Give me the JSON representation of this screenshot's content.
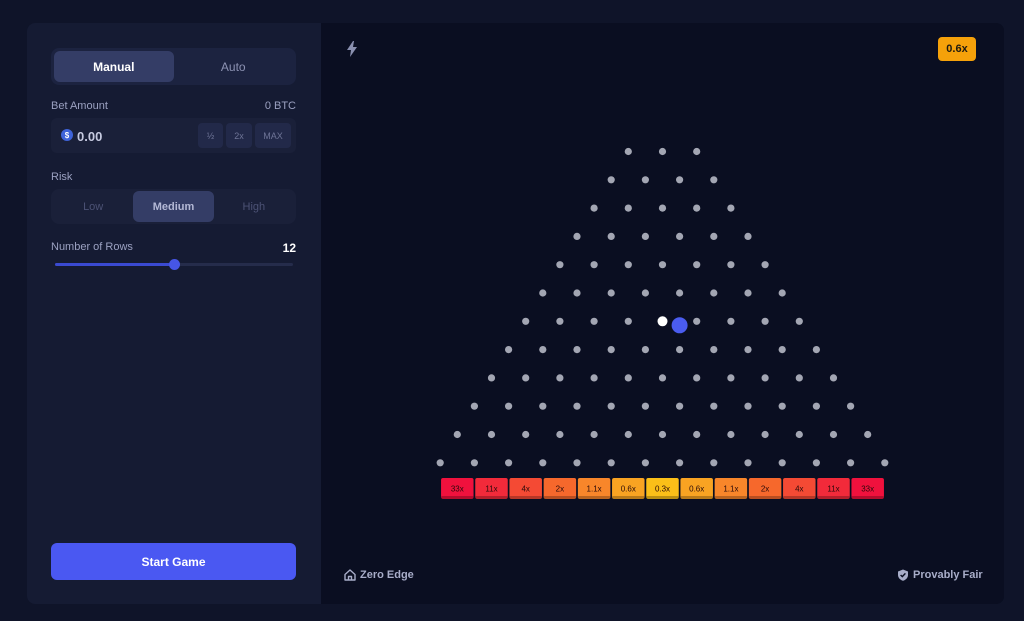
{
  "controls": {
    "tabs": [
      {
        "label": "Manual",
        "active": true
      },
      {
        "label": "Auto",
        "active": false
      }
    ],
    "bet": {
      "label": "Bet Amount",
      "balance": "0 BTC",
      "value": "0.00",
      "placeholder": "0.00",
      "currency_icon": "$",
      "half": "½",
      "double": "2x",
      "max": "MAX"
    },
    "risk": {
      "label": "Risk",
      "options": [
        "Low",
        "Medium",
        "High"
      ],
      "selected": "Medium"
    },
    "rows": {
      "label": "Number of Rows",
      "value": "12",
      "min": 8,
      "max": 16,
      "current": 12
    },
    "start_label": "Start Game"
  },
  "board": {
    "multiplier_badge": "0.6x",
    "rows": 12,
    "buckets": [
      "33x",
      "11x",
      "4x",
      "2x",
      "1.1x",
      "0.6x",
      "0.3x",
      "0.6x",
      "1.1x",
      "2x",
      "4x",
      "11x",
      "33x"
    ],
    "bucket_colors": [
      "#f0113d",
      "#f22a3a",
      "#f44a34",
      "#f6682c",
      "#f8862a",
      "#f9a322",
      "#fbbf18",
      "#f9a322",
      "#f8862a",
      "#f6682c",
      "#f44a34",
      "#f22a3a",
      "#f0113d"
    ],
    "peg_color": "#a3a6b3",
    "ball_color": "#4a5cf0",
    "ball": {
      "row": 6,
      "slot": 4.5
    },
    "ghost_ball_color": "#ffffff"
  },
  "footer": {
    "zero_edge": "Zero Edge",
    "provably_fair": "Provably Fair"
  }
}
